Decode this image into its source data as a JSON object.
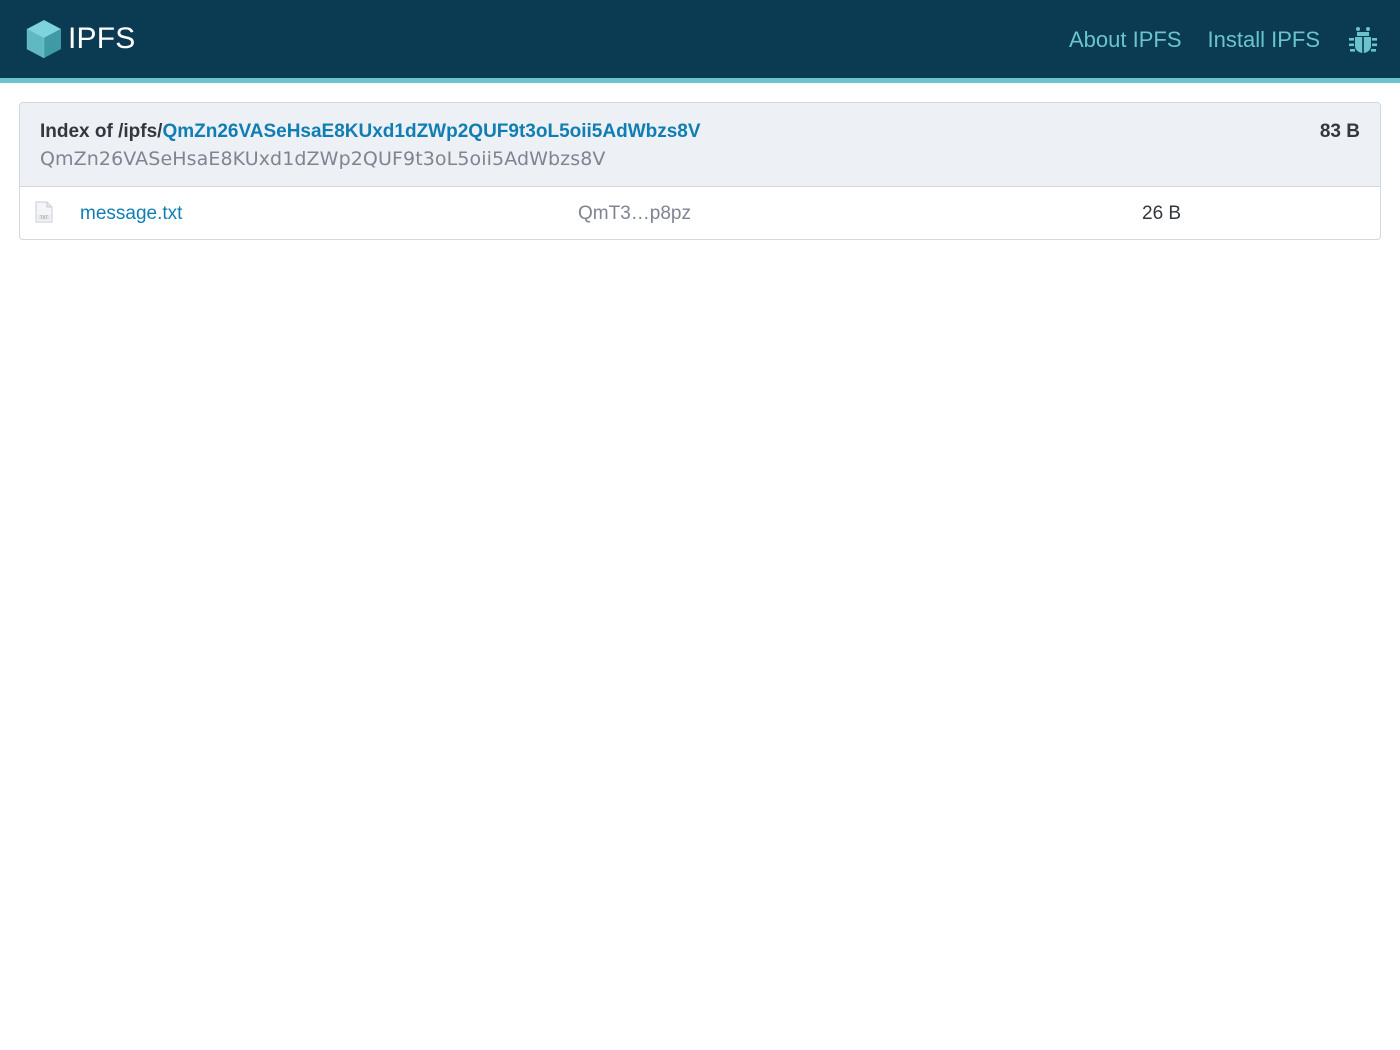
{
  "header": {
    "logo_text": "IPFS",
    "nav": {
      "about_label": "About IPFS",
      "install_label": "Install IPFS",
      "bug_icon": "bug-icon"
    },
    "colors": {
      "background": "#0b3a53",
      "accent": "#69c4cd"
    }
  },
  "listing": {
    "index_prefix": "Index of /ipfs/",
    "root_cid": "QmZn26VASeHsaE8KUxd1dZWp2QUF9t3oL5oii5AdWbzs8V",
    "cid_subtitle": "QmZn26VASeHsaE8KUxd1dZWp2QUF9t3oL5oii5AdWbzs8V",
    "total_size": "83 B",
    "files": [
      {
        "icon": "txt-file-icon",
        "name": "message.txt",
        "hash": "QmT3…p8pz",
        "size": "26 B"
      }
    ]
  }
}
